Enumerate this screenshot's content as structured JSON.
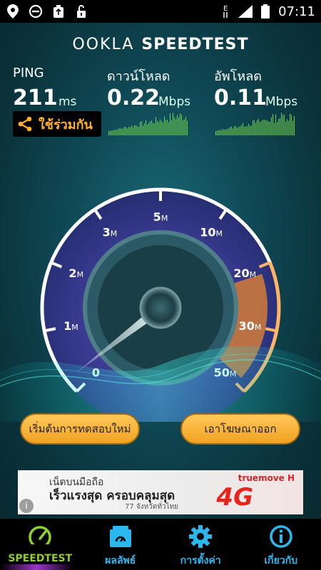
{
  "status_bar": {
    "time": "07:11",
    "network_letter": "E"
  },
  "header": {
    "logo_left": "OOKLA",
    "logo_right": "SPEEDTEST"
  },
  "ping": {
    "label": "PING",
    "value": "211",
    "unit": "ms"
  },
  "download": {
    "label": "ดาวน์โหลด",
    "value": "0.22",
    "unit": "Mbps"
  },
  "upload": {
    "label": "อัพโหลด",
    "value": "0.11",
    "unit": "Mbps"
  },
  "share": {
    "label": "ใช้ร่วมกัน"
  },
  "gauge": {
    "ticks": [
      {
        "num": "0",
        "suf": ""
      },
      {
        "num": "1",
        "suf": "M"
      },
      {
        "num": "2",
        "suf": "M"
      },
      {
        "num": "3",
        "suf": "M"
      },
      {
        "num": "5",
        "suf": "M"
      },
      {
        "num": "10",
        "suf": "M"
      },
      {
        "num": "20",
        "suf": "M"
      },
      {
        "num": "30",
        "suf": "M"
      },
      {
        "num": "50",
        "suf": "M"
      }
    ],
    "reading_mbps": 0.22
  },
  "buttons": {
    "restart": "เริ่มต้นการทดสอบใหม่",
    "remove_ads": "เอาโฆษณาออก"
  },
  "ad": {
    "line1": "เน็ตบนมือถือ",
    "line2": "เร็วแรงสุด ครอบคลุมสุด",
    "line3": "77 จังหวัดทั่วไทย",
    "brand": "truemove H",
    "badge": "4G"
  },
  "nav": {
    "items": [
      {
        "label": "SPEEDTEST",
        "icon": "speedometer-icon"
      },
      {
        "label": "ผลลัพธ์",
        "icon": "results-icon"
      },
      {
        "label": "การตั้งค่า",
        "icon": "gear-icon"
      },
      {
        "label": "เกี่ยวกับ",
        "icon": "info-icon"
      }
    ]
  },
  "colors": {
    "accent_orange": "#ffb02a",
    "nav_blue": "#2bb8ee",
    "nav_active_green": "#8fd02a",
    "graph_green": "#6fd24a"
  }
}
